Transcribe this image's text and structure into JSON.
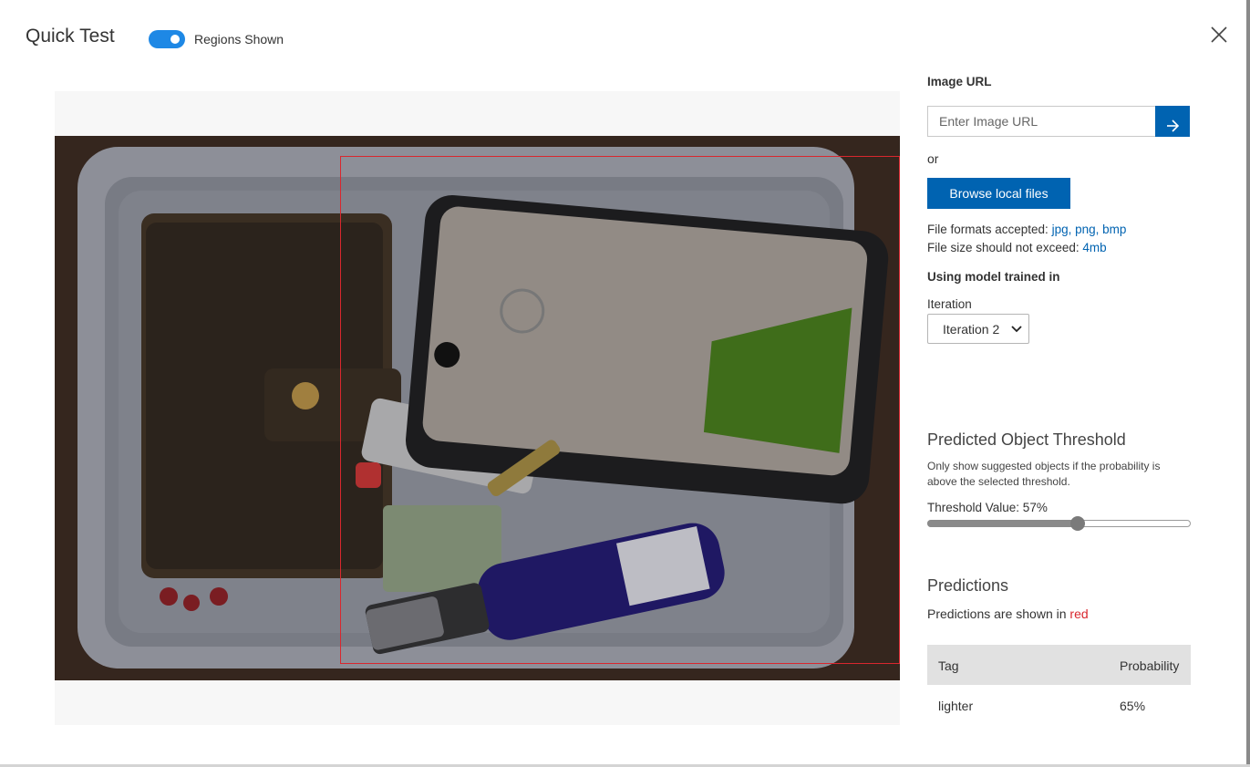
{
  "header": {
    "title": "Quick Test",
    "toggle_label": "Regions Shown",
    "toggle_on": true
  },
  "image_url": {
    "label": "Image URL",
    "placeholder": "Enter Image URL",
    "value": ""
  },
  "or_text": "or",
  "browse_button": "Browse local files",
  "file_formats": {
    "prefix": "File formats accepted:",
    "formats": "jpg, png, bmp"
  },
  "file_size": {
    "prefix": "File size should not exceed:",
    "limit": "4mb"
  },
  "model": {
    "heading": "Using model trained in",
    "iteration_label": "Iteration",
    "iteration_selected": "Iteration 2"
  },
  "threshold": {
    "title": "Predicted Object Threshold",
    "description": "Only show suggested objects if the probability is above the selected threshold.",
    "value_label": "Threshold Value: 57%",
    "value_percent": 57
  },
  "predictions": {
    "title": "Predictions",
    "note_prefix": "Predictions are shown in",
    "note_color_word": "red",
    "columns": [
      "Tag",
      "Probability"
    ],
    "rows": [
      {
        "tag": "lighter",
        "probability": "65%"
      }
    ]
  },
  "colors": {
    "accent": "#0063b1",
    "toggle": "#1e88e5",
    "region": "#d9272e"
  },
  "icons": {
    "close": "close-icon",
    "go": "arrow-right-icon",
    "dropdown": "chevron-down-icon"
  }
}
